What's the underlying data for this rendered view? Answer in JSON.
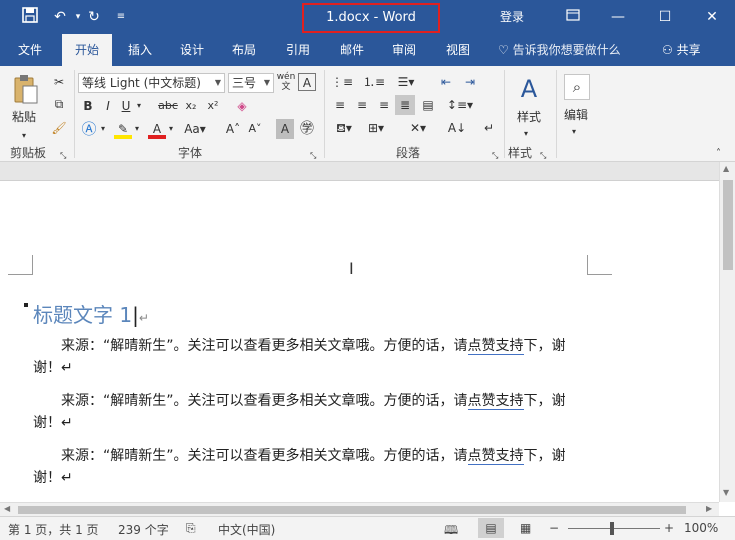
{
  "titlebar": {
    "title": "1.docx  -  Word",
    "login": "登录",
    "save_icon": "save-icon",
    "minimize": "—",
    "maximize": "☐",
    "close": "✕"
  },
  "tabs": [
    "文件",
    "开始",
    "插入",
    "设计",
    "布局",
    "引用",
    "邮件",
    "审阅",
    "视图"
  ],
  "active_tab": "开始",
  "tell_me": "告诉我你想要做什么",
  "share": "共享",
  "ribbon": {
    "paste_label": "粘贴",
    "clipboard_group": "剪贴板",
    "font_name": "等线 Light (中文标题)",
    "font_size": "三号",
    "font_group": "字体",
    "paragraph_group": "段落",
    "styles_label": "样式",
    "styles_group": "样式",
    "edit_label": "编辑"
  },
  "document": {
    "heading": "标题文字 1",
    "paragraphs": [
      {
        "pre": "来源：“解晴新生”。关注可以查看更多相关文章哦。方便的话，请",
        "link": "点赞支持",
        "post": "下，谢",
        "line2": "谢！↵"
      },
      {
        "pre": "来源：“解晴新生”。关注可以查看更多相关文章哦。方便的话，请",
        "link": "点赞支持",
        "post": "下，谢",
        "line2": "谢！↵"
      },
      {
        "pre": "来源：“解晴新生”。关注可以查看更多相关文章哦。方便的话，请",
        "link": "点赞支持",
        "post": "下，谢",
        "line2": "谢！↵"
      }
    ]
  },
  "statusbar": {
    "page": "第 1 页，共 1 页",
    "words": "239 个字",
    "language": "中文(中国)",
    "zoom": "100%",
    "zoom_percent": 100
  },
  "colors": {
    "accent": "#2b579a",
    "heading": "#5b86bb",
    "highlight_box": "#e02020"
  }
}
